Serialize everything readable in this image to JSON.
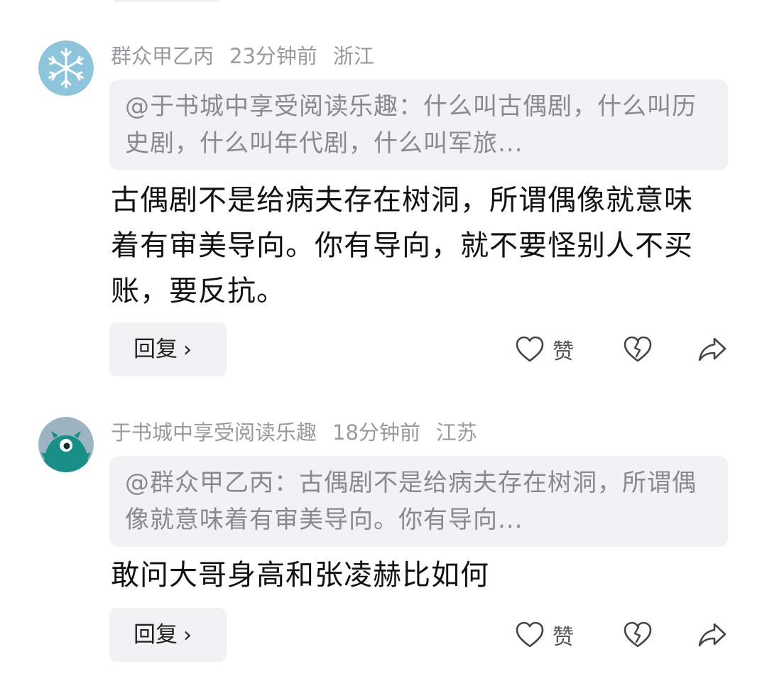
{
  "comments": [
    {
      "username": "群众甲乙丙",
      "time": "23分钟前",
      "location": "浙江",
      "quote": "@于书城中享受阅读乐趣：什么叫古偶剧，什么叫历史剧，什么叫年代剧，什么叫军旅...",
      "text": "古偶剧不是给病夫存在树洞，所谓偶像就意味着有审美导向。你有导向，就不要怪别人不买账，要反抗。",
      "reply_label": "回复",
      "like_label": "赞",
      "avatar_icon": "snowflake-icon"
    },
    {
      "username": "于书城中享受阅读乐趣",
      "time": "18分钟前",
      "location": "江苏",
      "quote": "@群众甲乙丙：古偶剧不是给病夫存在树洞，所谓偶像就意味着有审美导向。你有导向...",
      "text": "敢问大哥身高和张凌赫比如何",
      "reply_label": "回复",
      "like_label": "赞",
      "avatar_icon": "teal-monster-icon"
    }
  ],
  "colors": {
    "meta_text": "#9a9a9e",
    "quote_bg": "#f2f2f4",
    "body_text": "#111111"
  }
}
